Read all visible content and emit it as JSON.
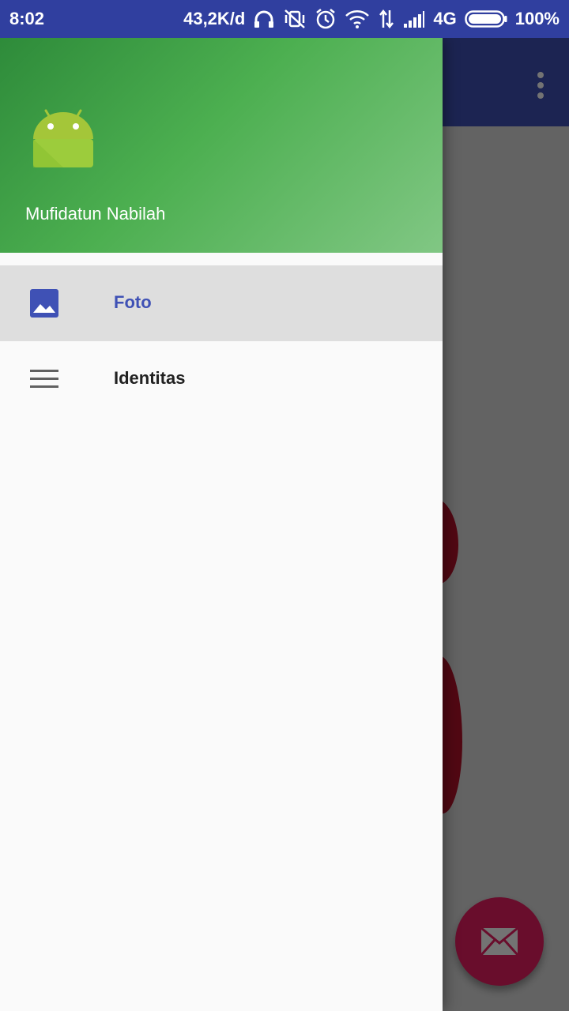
{
  "status_bar": {
    "time": "8:02",
    "net_speed": "43,2K/d",
    "network_type": "4G",
    "battery_percent": "100%",
    "icons": [
      "headphones-icon",
      "vibrate-off-icon",
      "alarm-icon",
      "wifi-icon",
      "data-arrows-icon",
      "signal-icon",
      "battery-icon"
    ]
  },
  "drawer": {
    "header": {
      "logo_icon": "android-logo-icon",
      "user_name": "Mufidatun Nabilah"
    },
    "menu": [
      {
        "label": "Foto",
        "icon": "image-icon",
        "selected": true
      },
      {
        "label": "Identitas",
        "icon": "menu-lines-icon",
        "selected": false
      }
    ]
  },
  "app": {
    "toolbar_color": "#3f51b5",
    "fab_icon": "mail-icon",
    "fab_color": "#e91e63",
    "overflow_icon": "more-vert-icon"
  },
  "colors": {
    "primary": "#3f51b5",
    "primary_dark": "#303f9f",
    "accent": "#e91e63",
    "header_green": "#4caf50"
  }
}
